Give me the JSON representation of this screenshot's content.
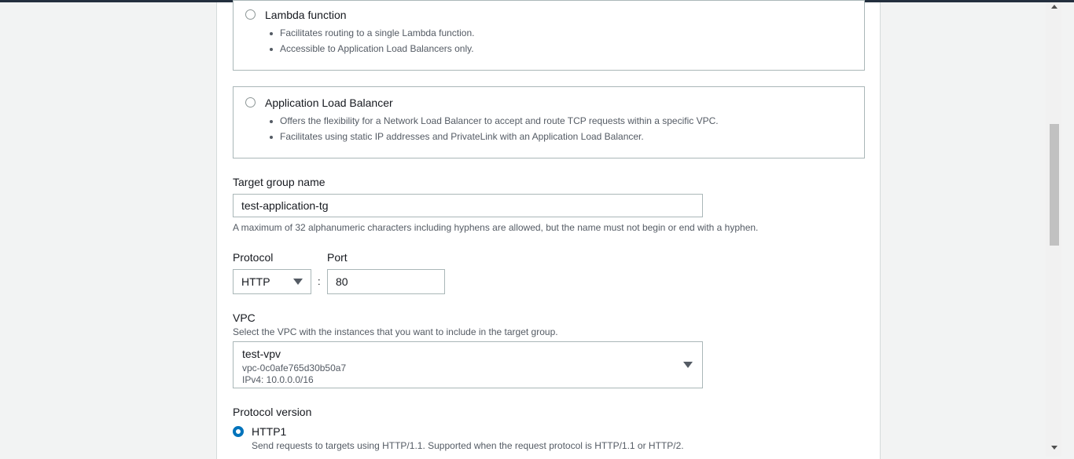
{
  "target_types": {
    "lambda": {
      "title": "Lambda function",
      "bullets": [
        "Facilitates routing to a single Lambda function.",
        "Accessible to Application Load Balancers only."
      ]
    },
    "alb": {
      "title": "Application Load Balancer",
      "bullets": [
        "Offers the flexibility for a Network Load Balancer to accept and route TCP requests within a specific VPC.",
        "Facilitates using static IP addresses and PrivateLink with an Application Load Balancer."
      ]
    }
  },
  "target_group_name": {
    "label": "Target group name",
    "value": "test-application-tg",
    "help": "A maximum of 32 alphanumeric characters including hyphens are allowed, but the name must not begin or end with a hyphen."
  },
  "protocol": {
    "label": "Protocol",
    "value": "HTTP"
  },
  "separator": ":",
  "port": {
    "label": "Port",
    "value": "80"
  },
  "vpc": {
    "label": "VPC",
    "help": "Select the VPC with the instances that you want to include in the target group.",
    "name": "test-vpv",
    "id": "vpc-0c0afe765d30b50a7",
    "cidr": "IPv4: 10.0.0.0/16"
  },
  "protocol_version": {
    "label": "Protocol version",
    "options": [
      {
        "title": "HTTP1",
        "description": "Send requests to targets using HTTP/1.1. Supported when the request protocol is HTTP/1.1 or HTTP/2.",
        "selected": true
      }
    ]
  },
  "colors": {
    "accent": "#0073bb",
    "border": "#aab7b8",
    "muted_text": "#545b64"
  }
}
